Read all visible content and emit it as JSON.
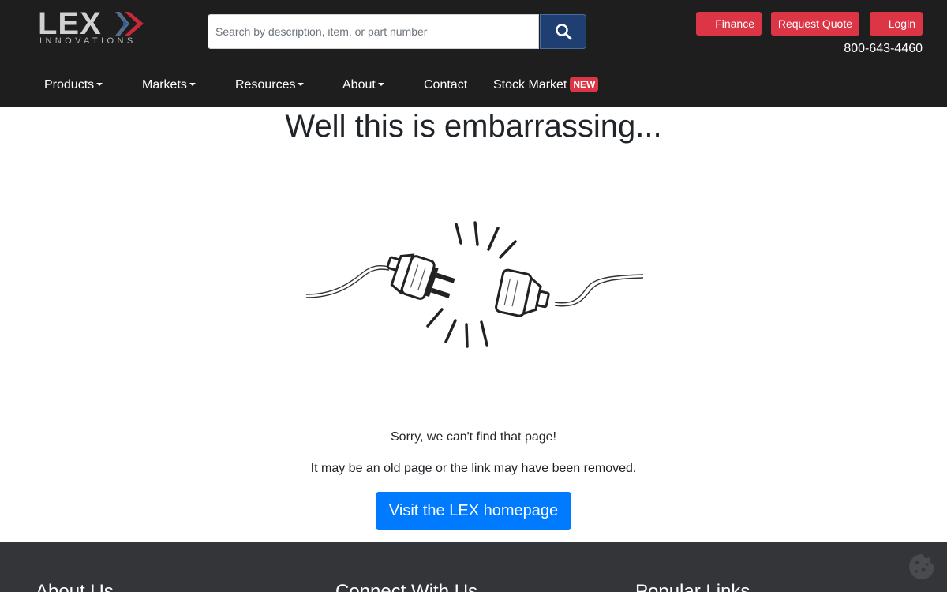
{
  "header": {
    "logo": {
      "word": "LEX",
      "sub": "INNOVATIONS"
    },
    "search": {
      "placeholder": "Search by description, item, or part number",
      "icon": "search-icon"
    },
    "buttons": {
      "finance": "Finance",
      "quote": "Request Quote",
      "login": "Login"
    },
    "phone": "800-643-4460",
    "colors": {
      "background": "#1e1e1e",
      "accent_red": "#dc3545",
      "search_button": "#1f3f73"
    }
  },
  "nav": {
    "products": "Products",
    "markets": "Markets",
    "resources": "Resources",
    "about": "About",
    "contact": "Contact",
    "stock": "Stock Market",
    "stock_badge": "NEW"
  },
  "main": {
    "title": "Well this is embarrassing...",
    "illustration": "unplugged-cable-icon",
    "msg1": "Sorry, we can't find that page!",
    "msg2": "It may be an old page or the link may have been removed.",
    "button": "Visit the LEX homepage",
    "button_color": "#007bff"
  },
  "footer": {
    "col1": "About Us",
    "col2": "Connect With Us",
    "col3": "Popular Links",
    "cookie_icon": "cookie-icon",
    "background": "#343538"
  }
}
